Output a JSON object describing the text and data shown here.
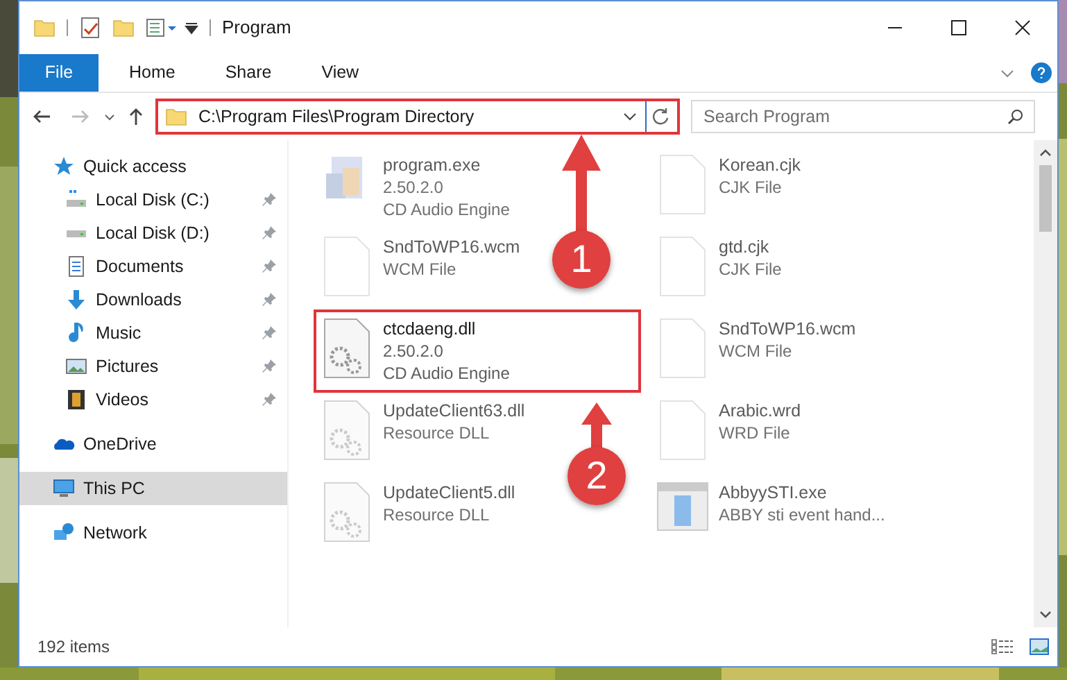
{
  "window": {
    "title": "Program"
  },
  "ribbon": {
    "tabs": [
      {
        "label": "File",
        "selected": true
      },
      {
        "label": "Home",
        "selected": false
      },
      {
        "label": "Share",
        "selected": false
      },
      {
        "label": "View",
        "selected": false
      }
    ]
  },
  "address": {
    "path": "C:\\Program Files\\Program Directory",
    "highlighted": true
  },
  "search": {
    "placeholder": "Search Program"
  },
  "sidebar": {
    "items": [
      {
        "label": "Quick access",
        "selected": false,
        "children": [
          {
            "label": "Local Disk (C:)",
            "pinned": true,
            "selected": false
          },
          {
            "label": "Local Disk (D:)",
            "pinned": true,
            "selected": false
          },
          {
            "label": "Documents",
            "pinned": true,
            "selected": false
          },
          {
            "label": "Downloads",
            "pinned": true,
            "selected": false
          },
          {
            "label": "Music",
            "pinned": true,
            "selected": false
          },
          {
            "label": "Pictures",
            "pinned": true,
            "selected": false
          },
          {
            "label": "Videos",
            "pinned": true,
            "selected": false
          }
        ]
      },
      {
        "label": "OneDrive",
        "selected": false
      },
      {
        "label": "This PC",
        "selected": true
      },
      {
        "label": "Network",
        "selected": false
      }
    ]
  },
  "files": [
    {
      "kind": "exe",
      "name": "program.exe",
      "lines": [
        "2.50.2.0",
        "CD Audio Engine"
      ],
      "blurred": true,
      "highlighted": false
    },
    {
      "kind": "doc",
      "name": "Korean.cjk",
      "lines": [
        "CJK File"
      ],
      "blurred": true,
      "highlighted": false
    },
    {
      "kind": "doc",
      "name": "SndToWP16.wcm",
      "lines": [
        "WCM File"
      ],
      "blurred": true,
      "highlighted": false
    },
    {
      "kind": "doc",
      "name": "gtd.cjk",
      "lines": [
        "CJK File"
      ],
      "blurred": true,
      "highlighted": false
    },
    {
      "kind": "dll",
      "name": "ctcdaeng.dll",
      "lines": [
        "2.50.2.0",
        "CD Audio Engine"
      ],
      "blurred": false,
      "highlighted": true
    },
    {
      "kind": "doc",
      "name": "SndToWP16.wcm",
      "lines": [
        "WCM File"
      ],
      "blurred": true,
      "highlighted": false
    },
    {
      "kind": "dll",
      "name": "UpdateClient63.dll",
      "lines": [
        "Resource DLL"
      ],
      "blurred": true,
      "highlighted": false
    },
    {
      "kind": "doc",
      "name": "Arabic.wrd",
      "lines": [
        "WRD File"
      ],
      "blurred": true,
      "highlighted": false
    },
    {
      "kind": "dll",
      "name": "UpdateClient5.dll",
      "lines": [
        "Resource DLL"
      ],
      "blurred": true,
      "highlighted": false
    },
    {
      "kind": "app",
      "name": "AbbyySTI.exe",
      "lines": [
        "ABBY sti event hand..."
      ],
      "blurred": true,
      "highlighted": false
    }
  ],
  "status_bar": {
    "count": "192 items"
  },
  "steps": [
    "1",
    "2"
  ]
}
